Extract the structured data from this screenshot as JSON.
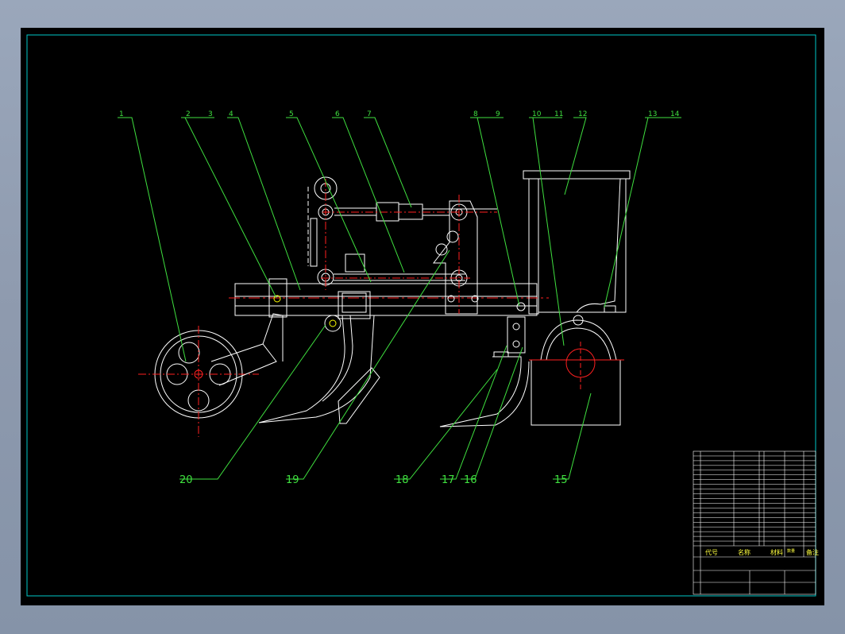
{
  "drawing": {
    "part_labels_top": [
      "1",
      "2",
      "3",
      "4",
      "5",
      "6",
      "7",
      "8",
      "9",
      "10",
      "11",
      "12",
      "13",
      "14"
    ],
    "part_labels_bottom": [
      "20",
      "19",
      "18",
      "17",
      "16",
      "15"
    ],
    "title_block": {
      "col_code": "代号",
      "col_name": "名称",
      "col_qty": "数量",
      "col_material": "材料",
      "col_note": "备注"
    }
  }
}
